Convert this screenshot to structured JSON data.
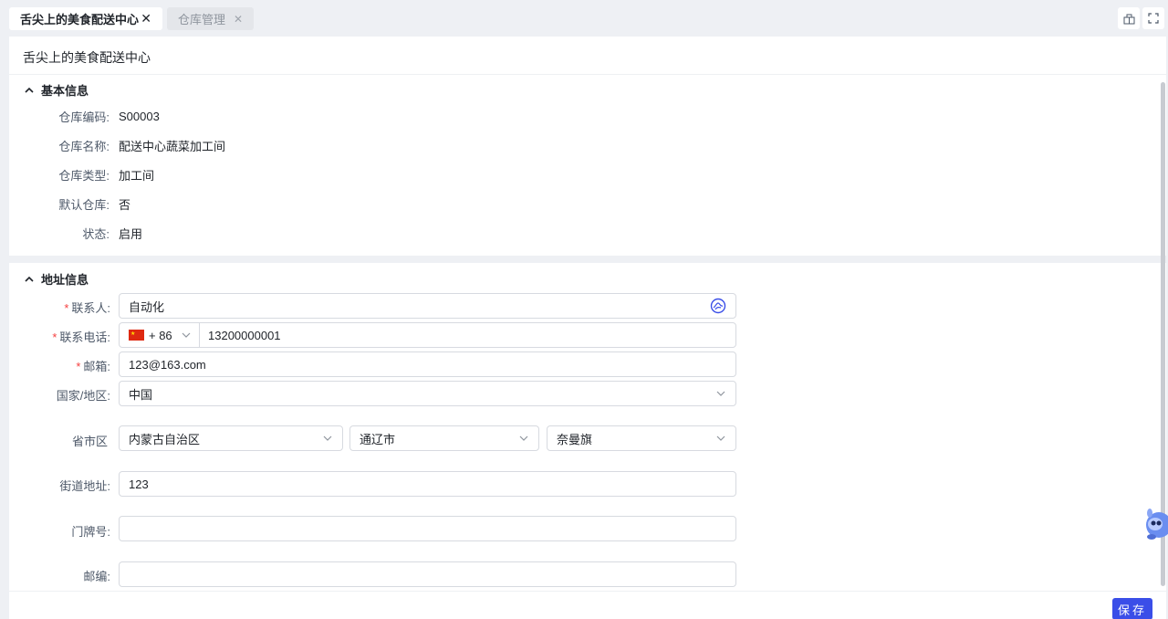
{
  "tabs": [
    {
      "label": "舌尖上的美食配送中心",
      "close": "✕"
    },
    {
      "label": "仓库管理",
      "close": "✕"
    }
  ],
  "page_title": "舌尖上的美食配送中心",
  "basic_section": {
    "title": "基本信息",
    "fields": [
      {
        "label": "仓库编码:",
        "value": "S00003"
      },
      {
        "label": "仓库名称:",
        "value": "配送中心蔬菜加工间"
      },
      {
        "label": "仓库类型:",
        "value": "加工间"
      },
      {
        "label": "默认仓库:",
        "value": "否"
      },
      {
        "label": "状态:",
        "value": "启用"
      }
    ]
  },
  "address_section": {
    "title": "地址信息",
    "required_mark": "*",
    "contact": {
      "label": "联系人:",
      "value": "自动化"
    },
    "phone": {
      "label": "联系电话:",
      "country_code": "+ 86",
      "value": "13200000001"
    },
    "email": {
      "label": "邮箱:",
      "value": "123@163.com"
    },
    "country": {
      "label": "国家/地区:",
      "value": "中国"
    },
    "region": {
      "label": "省市区",
      "province": "内蒙古自治区",
      "city": "通辽市",
      "district": "奈曼旗"
    },
    "street": {
      "label": "街道地址:",
      "value": "123"
    },
    "door": {
      "label": "门牌号:",
      "value": ""
    },
    "postcode": {
      "label": "邮编:",
      "value": ""
    }
  },
  "save_button": "保存",
  "colors": {
    "accent": "#3a4ee8",
    "required": "#f53f3f"
  }
}
